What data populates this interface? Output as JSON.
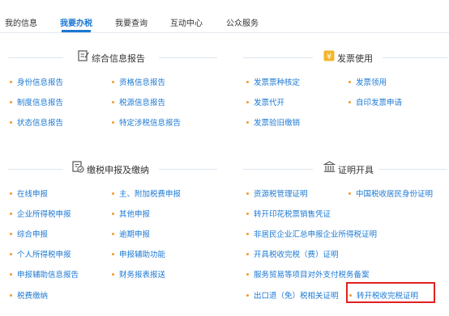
{
  "nav": {
    "tabs": [
      "我的信息",
      "我要办税",
      "我要查询",
      "互动中心",
      "公众服务"
    ]
  },
  "sections": {
    "info_report": {
      "title": "综合信息报告",
      "col1": [
        "身份信息报告",
        "制度信息报告",
        "状态信息报告"
      ],
      "col2": [
        "资格信息报告",
        "税源信息报告",
        "特定涉税信息报告"
      ]
    },
    "invoice": {
      "title": "发票使用",
      "col1": [
        "发票票种核定",
        "发票代开",
        "发票验旧缴销"
      ],
      "col2": [
        "发票领用",
        "自印发票申请"
      ]
    },
    "declare": {
      "title": "缴税申报及缴纳",
      "col1": [
        "在线申报",
        "企业所得税申报",
        "综合申报",
        "个人所得税申报",
        "申报辅助信息报告",
        "税费缴纳"
      ],
      "col2": [
        "主、附加税费申报",
        "其他申报",
        "逾期申报",
        "申报辅助功能",
        "财务报表报送"
      ]
    },
    "certificate": {
      "title": "证明开具",
      "items": [
        "资源税管理证明",
        "中国税收居民身份证明",
        "转开印花税票销售凭证",
        "非居民企业汇总申报企业所得税证明",
        "开具税收完税（费）证明",
        "服务贸易等项目对外支付税务备案",
        "出口退（免）税相关证明",
        "转开税收完税证明"
      ]
    }
  },
  "colors": {
    "accent": "#1b78d3",
    "bullet": "#f39a2a",
    "highlight": "#e02020"
  }
}
